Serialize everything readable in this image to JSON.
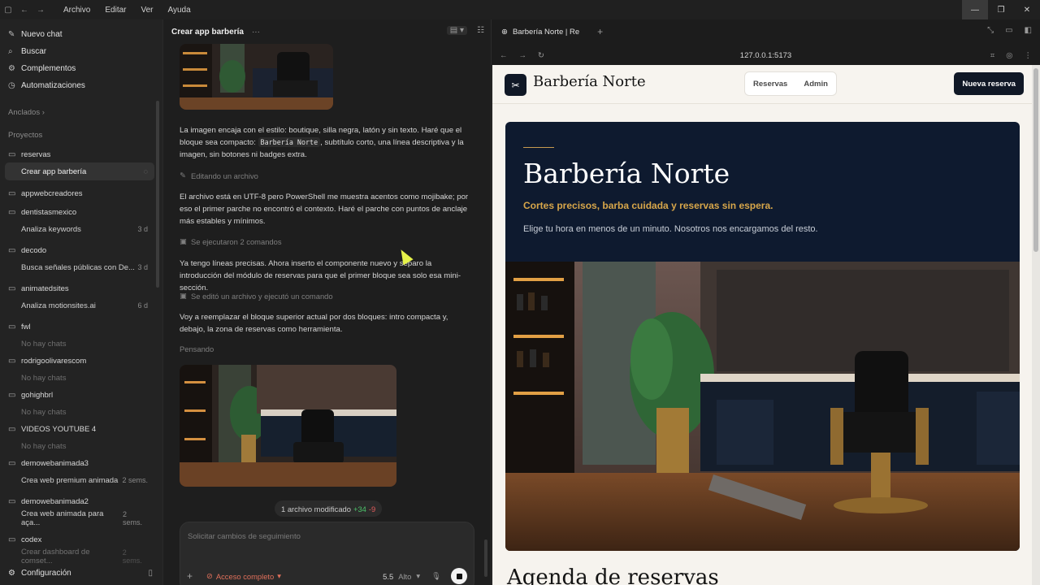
{
  "menu": [
    "Archivo",
    "Editar",
    "Ver",
    "Ayuda"
  ],
  "sidebar": {
    "top": [
      {
        "label": "Nuevo chat",
        "icon": "edit-icon"
      },
      {
        "label": "Buscar",
        "icon": "search-icon"
      },
      {
        "label": "Complementos",
        "icon": "plugin-icon"
      },
      {
        "label": "Automatizaciones",
        "icon": "clock-icon"
      }
    ],
    "pinned_label": "Anclados",
    "projects_label": "Proyectos",
    "projects": [
      {
        "name": "reservas",
        "chats": [
          {
            "title": "Crear app barbería",
            "meta": "",
            "active": true
          }
        ]
      },
      {
        "name": "appwebcreadores",
        "chats": []
      },
      {
        "name": "dentistasmexico",
        "chats": [
          {
            "title": "Analiza keywords",
            "meta": "3 d"
          }
        ]
      },
      {
        "name": "decodo",
        "chats": [
          {
            "title": "Busca señales públicas con De...",
            "meta": "3 d"
          }
        ]
      },
      {
        "name": "animatedsites",
        "chats": [
          {
            "title": "Analiza motionsites.ai",
            "meta": "6 d"
          }
        ]
      },
      {
        "name": "fwl",
        "chats": [
          {
            "title": "No hay chats",
            "empty": true
          }
        ]
      },
      {
        "name": "rodrigoolivarescom",
        "chats": [
          {
            "title": "No hay chats",
            "empty": true
          }
        ]
      },
      {
        "name": "gohighbrl",
        "chats": [
          {
            "title": "No hay chats",
            "empty": true
          }
        ]
      },
      {
        "name": "VIDEOS YOUTUBE 4",
        "chats": [
          {
            "title": "No hay chats",
            "empty": true
          }
        ]
      },
      {
        "name": "demowebanimada3",
        "chats": [
          {
            "title": "Crea web premium animada",
            "meta": "2 sems."
          }
        ]
      },
      {
        "name": "demowebanimada2",
        "chats": [
          {
            "title": "Crea web animada para aça...",
            "meta": "2 sems."
          }
        ]
      },
      {
        "name": "codex",
        "chats": [
          {
            "title": "Crear dashboard de comset...",
            "meta": "2 sems."
          }
        ]
      }
    ],
    "footer_label": "Configuración"
  },
  "chat": {
    "title": "Crear app barbería",
    "messages": [
      {
        "text_before": "La imagen encaja con el estilo: boutique, silla negra, latón y sin texto. Haré que el bloque sea compacto: ",
        "code": "Barbería Norte",
        "text_after": ", subtítulo corto, una línea descriptiva y la imagen, sin botones ni badges extra."
      },
      {
        "text": "El archivo está en UTF-8 pero PowerShell me muestra acentos como mojibake; por eso el primer parche no encontró el contexto. Haré el parche con puntos de anclaje más estables y mínimos."
      },
      {
        "text": "Ya tengo líneas precisas. Ahora inserto el componente nuevo y separo la introducción del módulo de reservas para que el primer bloque sea solo esa mini-sección."
      },
      {
        "text": "Voy a reemplazar el bloque superior actual por dos bloques: intro compacta y, debajo, la zona de reservas como herramienta."
      }
    ],
    "status": [
      "Editando un archivo",
      "Se ejecutaron 2 comandos",
      "Se editó un archivo y ejecutó un comando",
      "Pensando"
    ],
    "diff": {
      "label": "1 archivo modificado",
      "added": "+34",
      "removed": "-9"
    },
    "composer": {
      "placeholder": "Solicitar cambios de seguimiento",
      "access": "Acceso completo",
      "model": "5.5",
      "effort": "Alto"
    }
  },
  "browser": {
    "tab_title": "Barbería Norte | Re",
    "url": "127.0.0.1:5173"
  },
  "site": {
    "brand": "Barbería Norte",
    "nav": [
      "Reservas",
      "Admin"
    ],
    "cta": "Nueva reserva",
    "hero_title": "Barbería Norte",
    "hero_subtitle": "Cortes precisos, barba cuidada y reservas sin espera.",
    "hero_desc": "Elige tu hora en menos de un minuto. Nosotros nos encargamos del resto.",
    "next_section": "Agenda de reservas"
  },
  "colors": {
    "accent_gold": "#d7a64a",
    "navy": "#0e1a2f",
    "access_red": "#e0705b",
    "diff_add": "#4cc36a",
    "diff_del": "#e25c5c"
  }
}
